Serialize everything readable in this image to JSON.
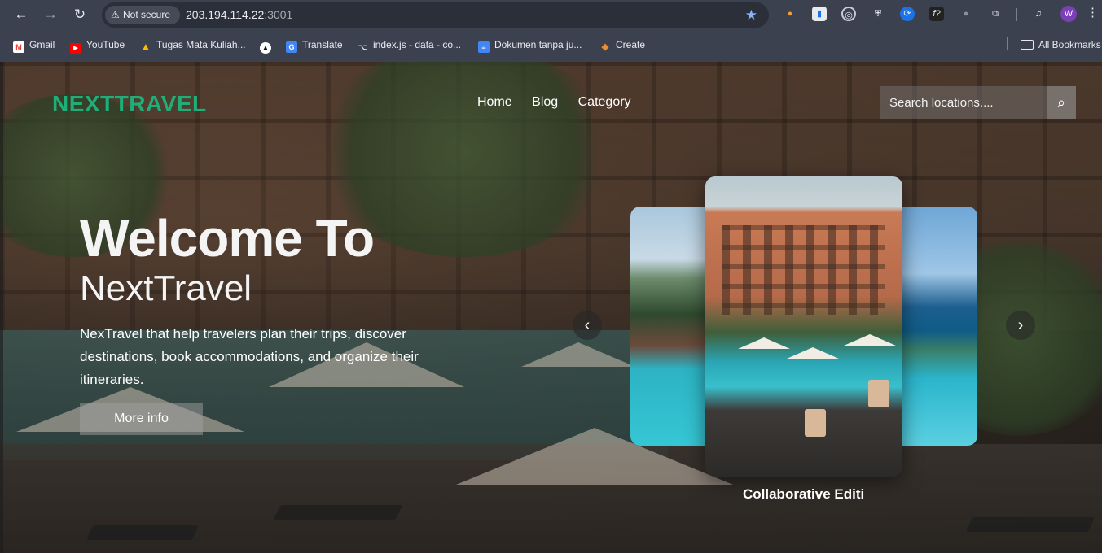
{
  "browser": {
    "nav": {
      "back": "←",
      "forward": "→",
      "reload": "↻"
    },
    "security_label": "Not secure",
    "url_host": "203.194.114.22",
    "url_port": ":3001",
    "bookmarks": [
      {
        "label": "Gmail",
        "icon": "gmail-icon",
        "glyph": "M",
        "color": "#ea4335"
      },
      {
        "label": "YouTube",
        "icon": "youtube-icon",
        "glyph": "▶",
        "color": "#ff0000"
      },
      {
        "label": "Tugas Mata Kuliah...",
        "icon": "drive-icon",
        "glyph": "▲",
        "color": "#34a853"
      },
      {
        "label": "",
        "icon": "triangle-logo-icon",
        "glyph": "▲",
        "color": "#111111"
      },
      {
        "label": "Translate",
        "icon": "translate-icon",
        "glyph": "G",
        "color": "#4285f4"
      },
      {
        "label": "index.js - data - co...",
        "icon": "github-icon",
        "glyph": "⌥",
        "color": "#3c4150"
      },
      {
        "label": "Dokumen tanpa ju...",
        "icon": "docs-icon",
        "glyph": "≡",
        "color": "#4285f4"
      },
      {
        "label": "Create",
        "icon": "create-icon",
        "glyph": "◆",
        "color": "#f28c28"
      }
    ],
    "all_bookmarks": "All Bookmarks",
    "profile_initial": "W"
  },
  "site": {
    "logo": "NEXTTRAVEL",
    "nav": {
      "home": "Home",
      "blog": "Blog",
      "category": "Category"
    },
    "search_placeholder": "Search locations....",
    "hero": {
      "title": "Welcome To",
      "subtitle": "NextTravel",
      "description": "NexTravel that help travelers plan their trips, discover destinations, book accommodations, and organize their itineraries.",
      "button": "More info"
    },
    "carousel": {
      "caption": "Collaborative Editi",
      "prev": "‹",
      "next": "›"
    }
  },
  "colors": {
    "logo": "#1fae77",
    "browser_bg": "#3c4150",
    "star": "#8ab4f8"
  }
}
